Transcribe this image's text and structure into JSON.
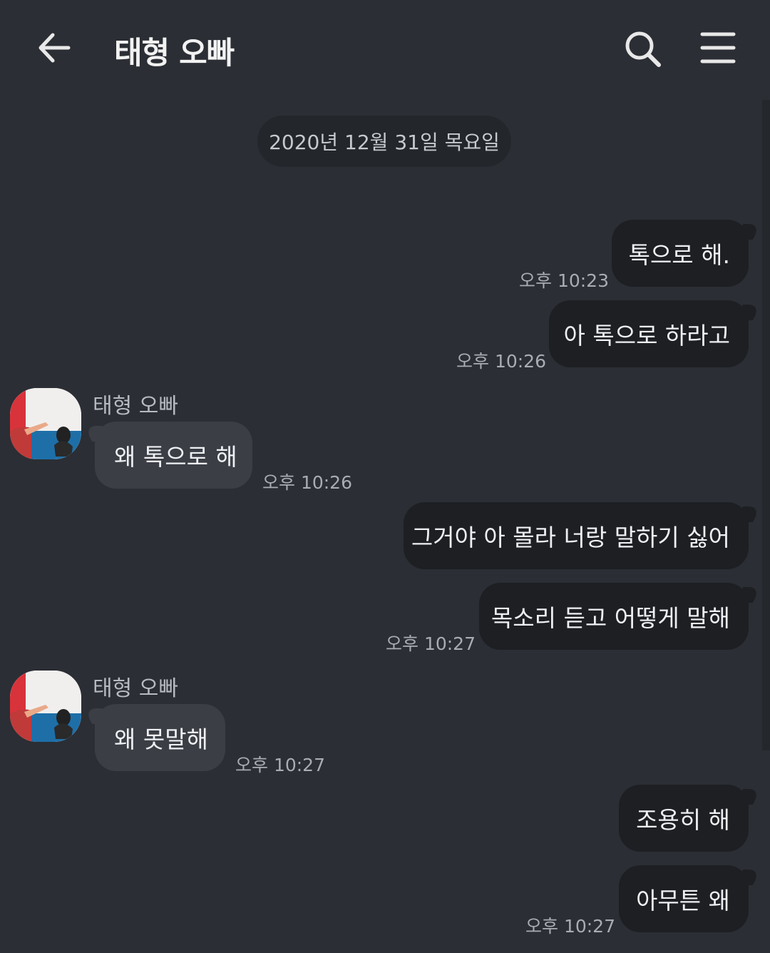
{
  "header": {
    "title": "태형 오빠"
  },
  "date_divider": "2020년 12월 31일 목요일",
  "messages": [
    {
      "side": "me",
      "text": "톡으로 해.",
      "time": "오후 10:23"
    },
    {
      "side": "me",
      "text": "아 톡으로 하라고",
      "time": "오후 10:26"
    },
    {
      "side": "them",
      "sender": "태형 오빠",
      "text": "왜 톡으로 해",
      "time": "오후 10:26"
    },
    {
      "side": "me",
      "text": "그거야 아 몰라 너랑 말하기 싫어",
      "time": ""
    },
    {
      "side": "me",
      "text": "목소리 듣고 어떻게 말해",
      "time": "오후 10:27"
    },
    {
      "side": "them",
      "sender": "태형 오빠",
      "text": "왜 못말해",
      "time": "오후 10:27"
    },
    {
      "side": "me",
      "text": "조용히 해",
      "time": ""
    },
    {
      "side": "me",
      "text": "아무튼 왜",
      "time": "오후 10:27"
    }
  ],
  "colors": {
    "background": "#2b2e34",
    "my_bubble": "#1d1f23",
    "their_bubble": "#3b3e45",
    "timestamp": "#a9adb3"
  }
}
